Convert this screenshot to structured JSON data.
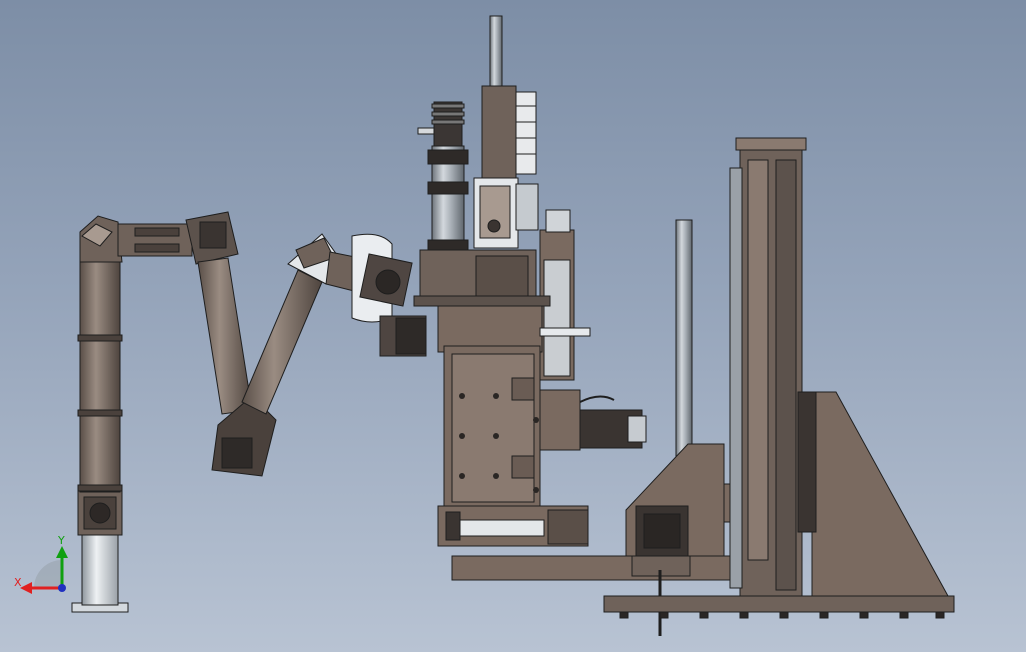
{
  "viewport": {
    "background_top": "#7d8ea6",
    "background_bottom": "#b8c3d3"
  },
  "colors": {
    "part_brown": "#7a6a60",
    "part_dark": "#3e3835",
    "metal_light": "#c8cdd3",
    "metal_mid": "#9aa1a8",
    "edge": "#1e1e1e"
  },
  "triad": {
    "x_label": "X",
    "y_label": "Y",
    "x_color": "#e02020",
    "y_color": "#10a010",
    "z_color": "#2030c0"
  }
}
